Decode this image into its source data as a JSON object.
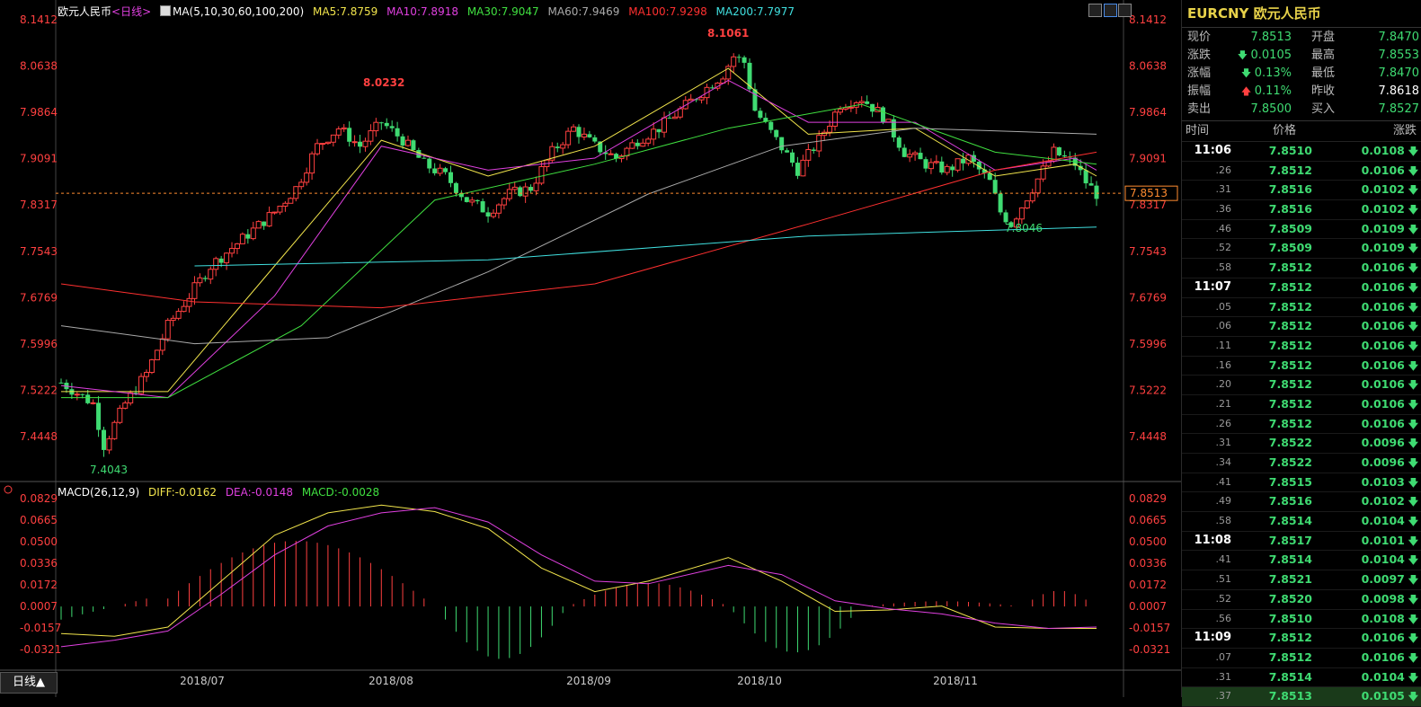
{
  "chart": {
    "symbol_title": "欧元人民币",
    "period": "<日线>",
    "ma_params": "MA(5,10,30,60,100,200)",
    "ma_values": [
      {
        "label": "MA5:7.8759",
        "color": "#f2e54c"
      },
      {
        "label": "MA10:7.8918",
        "color": "#e040e0"
      },
      {
        "label": "MA30:7.9047",
        "color": "#40e040"
      },
      {
        "label": "MA60:7.9469",
        "color": "#aaaaaa"
      },
      {
        "label": "MA100:7.9298",
        "color": "#ff3030"
      },
      {
        "label": "MA200:7.7977",
        "color": "#40e0e0"
      }
    ],
    "macd_title": "MACD(26,12,9)",
    "macd_values": [
      {
        "label": "DIFF:-0.0162",
        "color": "#f2e54c"
      },
      {
        "label": "DEA:-0.0148",
        "color": "#e040e0"
      },
      {
        "label": "MACD:-0.0028",
        "color": "#40e040"
      }
    ],
    "price_ticks": [
      "8.1412",
      "8.0638",
      "7.9864",
      "7.9091",
      "7.8317",
      "7.7543",
      "7.6769",
      "7.5996",
      "7.5222",
      "7.4448"
    ],
    "macd_ticks": [
      "0.0829",
      "0.0665",
      "0.0500",
      "0.0336",
      "0.0172",
      "0.0007",
      "-0.0157",
      "-0.0321"
    ],
    "month_labels": [
      "2018/07",
      "2018/08",
      "2018/09",
      "2018/10",
      "2018/11"
    ],
    "current_price": "7.8513",
    "high_label": "8.1061",
    "mid_high_label": "8.0232",
    "low_label": "7.4043",
    "recent_low_label": "7.8046",
    "bottom_tab": "日线▲",
    "colors": {
      "up": "#ff4040",
      "down": "#3fdb72",
      "axis": "#ff4040"
    }
  },
  "chart_data": {
    "type": "candlestick",
    "y_axis_ticks": [
      8.1412,
      8.0638,
      7.9864,
      7.9091,
      7.8317,
      7.7543,
      7.6769,
      7.5996,
      7.5222,
      7.4448
    ],
    "annotations": {
      "max": 8.1061,
      "local_high": 8.0232,
      "min": 7.4043,
      "recent_low": 7.8046,
      "last": 7.8513
    },
    "macd_axis_ticks": [
      0.0829,
      0.0665,
      0.05,
      0.0336,
      0.0172,
      0.0007,
      -0.0157,
      -0.0321
    ],
    "x_labels": [
      "2018/07",
      "2018/08",
      "2018/09",
      "2018/10",
      "2018/11"
    ]
  },
  "side": {
    "title": "EURCNY 欧元人民币",
    "quotes": [
      {
        "k1": "现价",
        "v1": "7.8513",
        "c1": "#3fdb72",
        "k2": "开盘",
        "v2": "7.8470",
        "c2": "#3fdb72"
      },
      {
        "k1": "涨跌",
        "v1": "0.0105",
        "c1": "#3fdb72",
        "arrow1": "down",
        "k2": "最高",
        "v2": "7.8553",
        "c2": "#3fdb72"
      },
      {
        "k1": "涨幅",
        "v1": "0.13%",
        "c1": "#3fdb72",
        "arrow1": "down",
        "k2": "最低",
        "v2": "7.8470",
        "c2": "#3fdb72"
      },
      {
        "k1": "振幅",
        "v1": "0.11%",
        "c1": "#3fdb72",
        "arrow1": "up",
        "k2": "昨收",
        "v2": "7.8618",
        "c2": "#ffffff"
      },
      {
        "k1": "卖出",
        "v1": "7.8500",
        "c1": "#3fdb72",
        "k2": "买入",
        "v2": "7.8527",
        "c2": "#3fdb72"
      }
    ],
    "tick_header": [
      "时间",
      "价格",
      "涨跌"
    ],
    "ticks": [
      {
        "t": "11:06",
        "big": true,
        "p": "7.8510",
        "c": "0.0108"
      },
      {
        "t": ".26",
        "p": "7.8512",
        "c": "0.0106"
      },
      {
        "t": ".31",
        "p": "7.8516",
        "c": "0.0102"
      },
      {
        "t": ".36",
        "p": "7.8516",
        "c": "0.0102"
      },
      {
        "t": ".46",
        "p": "7.8509",
        "c": "0.0109"
      },
      {
        "t": ".52",
        "p": "7.8509",
        "c": "0.0109"
      },
      {
        "t": ".58",
        "p": "7.8512",
        "c": "0.0106"
      },
      {
        "t": "11:07",
        "big": true,
        "p": "7.8512",
        "c": "0.0106"
      },
      {
        "t": ".05",
        "p": "7.8512",
        "c": "0.0106"
      },
      {
        "t": ".06",
        "p": "7.8512",
        "c": "0.0106"
      },
      {
        "t": ".11",
        "p": "7.8512",
        "c": "0.0106"
      },
      {
        "t": ".16",
        "p": "7.8512",
        "c": "0.0106"
      },
      {
        "t": ".20",
        "p": "7.8512",
        "c": "0.0106"
      },
      {
        "t": ".21",
        "p": "7.8512",
        "c": "0.0106"
      },
      {
        "t": ".26",
        "p": "7.8512",
        "c": "0.0106"
      },
      {
        "t": ".31",
        "p": "7.8522",
        "c": "0.0096"
      },
      {
        "t": ".34",
        "p": "7.8522",
        "c": "0.0096"
      },
      {
        "t": ".41",
        "p": "7.8515",
        "c": "0.0103"
      },
      {
        "t": ".49",
        "p": "7.8516",
        "c": "0.0102"
      },
      {
        "t": ".58",
        "p": "7.8514",
        "c": "0.0104"
      },
      {
        "t": "11:08",
        "big": true,
        "p": "7.8517",
        "c": "0.0101"
      },
      {
        "t": ".41",
        "p": "7.8514",
        "c": "0.0104"
      },
      {
        "t": ".51",
        "p": "7.8521",
        "c": "0.0097"
      },
      {
        "t": ".52",
        "p": "7.8520",
        "c": "0.0098"
      },
      {
        "t": ".56",
        "p": "7.8510",
        "c": "0.0108"
      },
      {
        "t": "11:09",
        "big": true,
        "p": "7.8512",
        "c": "0.0106"
      },
      {
        "t": ".07",
        "p": "7.8512",
        "c": "0.0106"
      },
      {
        "t": ".31",
        "p": "7.8514",
        "c": "0.0104"
      },
      {
        "t": ".37",
        "p": "7.8513",
        "c": "0.0105"
      }
    ]
  }
}
